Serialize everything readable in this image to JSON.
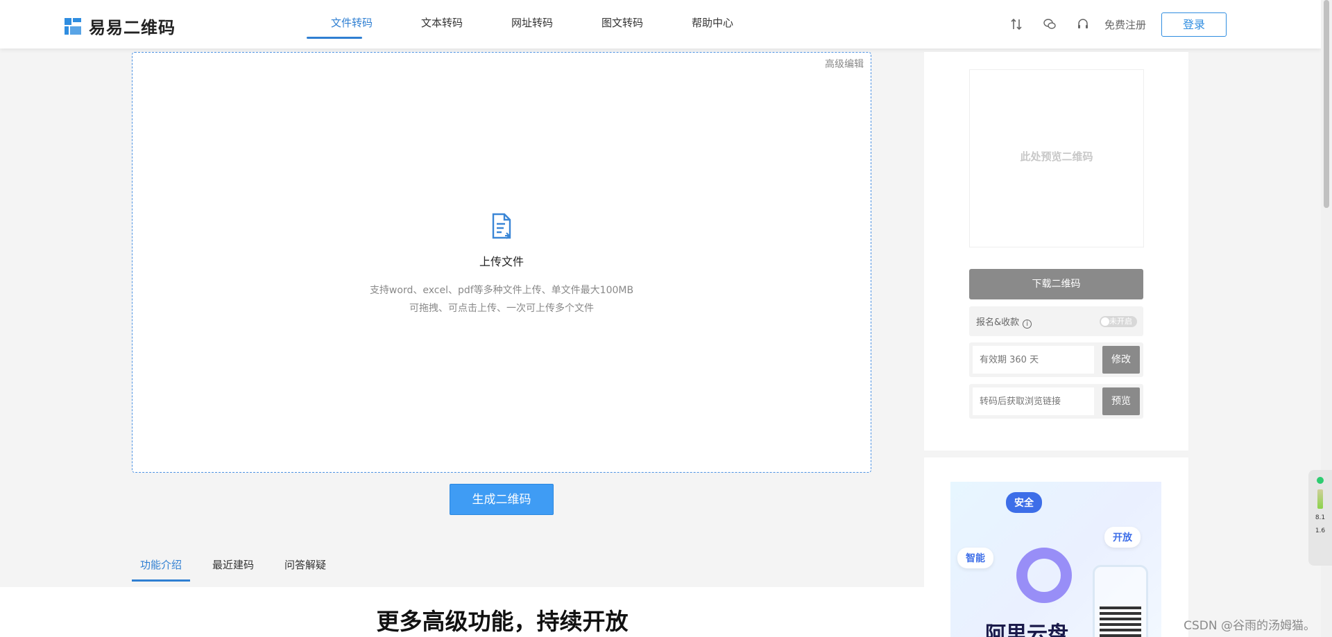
{
  "header": {
    "logo_text": "易易二维码",
    "nav": [
      "文件转码",
      "文本转码",
      "网址转码",
      "图文转码",
      "帮助中心"
    ],
    "active_nav": "文件转码",
    "register_label": "免费注册",
    "login_label": "登录"
  },
  "upload": {
    "advanced_edit": "高级编辑",
    "title": "上传文件",
    "desc_line1": "支持word、excel、pdf等多种文件上传、单文件最大100MB",
    "desc_line2": "可拖拽、可点击上传、一次可上传多个文件"
  },
  "generate_button": "生成二维码",
  "tabs": [
    "功能介绍",
    "最近建码",
    "问答解疑"
  ],
  "lower": {
    "title": "更多高级功能，持续开放"
  },
  "sidebar": {
    "preview_text": "此处预览二维码",
    "download_label": "下载二维码",
    "signup_label": "报名&收款",
    "toggle_label": "未开启",
    "validity_placeholder": "有效期 360 天",
    "modify_label": "修改",
    "browse_placeholder": "转码后获取浏览链接",
    "preview_label": "预览"
  },
  "ad": {
    "bubble_safe": "安全",
    "bubble_open": "开放",
    "bubble_smart": "智能",
    "brand": "阿里云盘"
  },
  "widget": {
    "val1": "8.1",
    "val2": "1.6"
  },
  "watermark": "CSDN @谷雨的汤姆猫。",
  "colors": {
    "accent": "#2f7fd2",
    "generate_button": "#3f9cf4",
    "disabled_button": "#8a8a8a"
  },
  "icons": [
    "sort-icon",
    "wechat-icon",
    "headset-icon",
    "document-icon",
    "info-icon"
  ]
}
